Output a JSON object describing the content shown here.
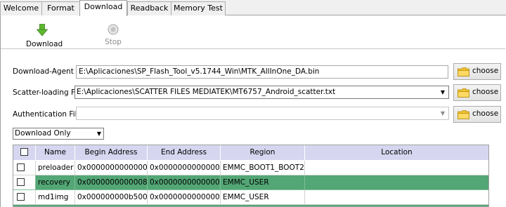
{
  "tabs": [
    "Welcome",
    "Format",
    "Download",
    "Readback",
    "Memory Test"
  ],
  "toolbar": {
    "download_label": "Download",
    "stop_label": "Stop"
  },
  "fields": {
    "download_agent": {
      "label": "Download-Agent",
      "value": "E:\\Aplicaciones\\SP_Flash_Tool_v5.1744_Win\\MTK_AllInOne_DA.bin"
    },
    "scatter": {
      "label": "Scatter-loading File",
      "value": "E:\\Aplicaciones\\SCATTER FILES MEDIATEK\\MT6757_Android_scatter.txt"
    },
    "auth": {
      "label": "Authentication File",
      "value": ""
    },
    "choose_label": "choose"
  },
  "mode_select": {
    "value": "Download Only"
  },
  "table": {
    "columns": [
      "Name",
      "Begin Address",
      "End Address",
      "Region",
      "Location"
    ],
    "rows": [
      {
        "name": "preloader",
        "begin": "0x0000000000000000",
        "end": "0x0000000000000000",
        "region": "EMMC_BOOT1_BOOT2",
        "location": "",
        "selected": false
      },
      {
        "name": "recovery",
        "begin": "0x0000000000008000",
        "end": "0x0000000000000000",
        "region": "EMMC_USER",
        "location": "",
        "selected": true
      },
      {
        "name": "md1img",
        "begin": "0x000000000b500000",
        "end": "0x0000000000000000",
        "region": "EMMC_USER",
        "location": "",
        "selected": false
      }
    ]
  },
  "colors": {
    "selected_row": "#53a675",
    "header_bg": "#d6d6f0"
  }
}
